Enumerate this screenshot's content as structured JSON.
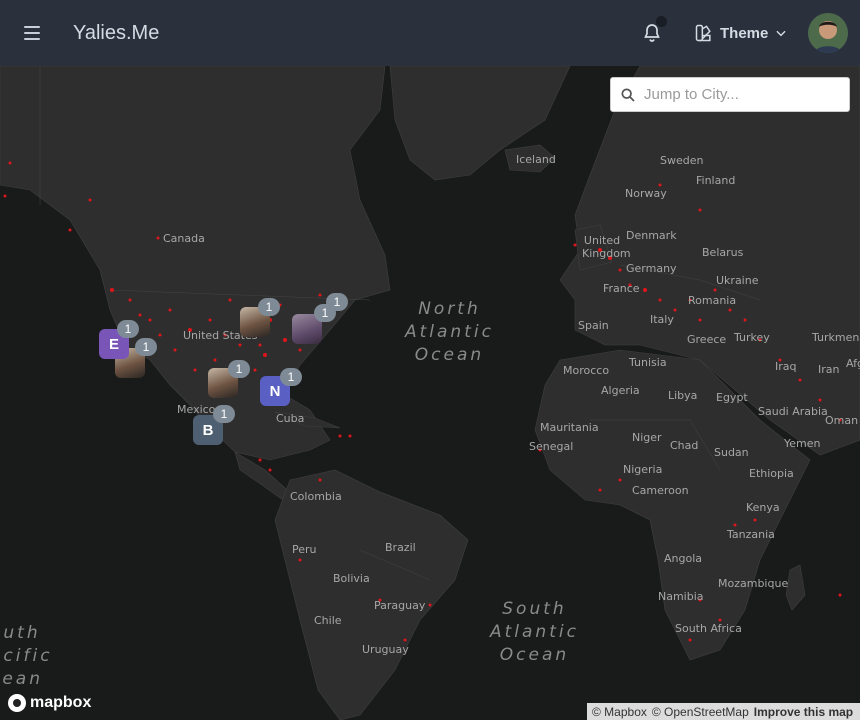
{
  "header": {
    "brand": "Yalies.Me",
    "theme_label": "Theme"
  },
  "search": {
    "placeholder": "Jump to City..."
  },
  "map": {
    "ocean_labels": {
      "north_atlantic": "North\nAtlantic\nOcean",
      "south_atlantic": "South\nAtlantic\nOcean",
      "south_pacific": "outh\nacific\ncean"
    },
    "place_labels": [
      "Iceland",
      "Sweden",
      "Finland",
      "Norway",
      "United Kingdom",
      "Denmark",
      "Belarus",
      "Germany",
      "Ukraine",
      "France",
      "Romania",
      "Spain",
      "Italy",
      "Turkey",
      "Greece",
      "Turkmen",
      "Tunisia",
      "Iraq",
      "Iran",
      "Afg",
      "Morocco",
      "Algeria",
      "Libya",
      "Egypt",
      "Saudi Arabia",
      "Oman",
      "Mauritania",
      "Niger",
      "Chad",
      "Sudan",
      "Yemen",
      "Senegal",
      "Nigeria",
      "Ethiopia",
      "Cameroon",
      "Kenya",
      "Tanzania",
      "Angola",
      "Mozambique",
      "Namibia",
      "South Africa",
      "Canada",
      "United States",
      "Mexico",
      "Cuba",
      "Colombia",
      "Peru",
      "Brazil",
      "Bolivia",
      "Paraguay",
      "Chile",
      "Uruguay"
    ],
    "markers": [
      {
        "type": "letter",
        "text": "E",
        "color": "#7a55b8",
        "count": "1"
      },
      {
        "type": "letter",
        "text": "N",
        "color": "#5a5fc4",
        "count": "1"
      },
      {
        "type": "letter",
        "text": "B",
        "color": "#4e5f72",
        "count": "1"
      },
      {
        "type": "photo",
        "count": "1"
      },
      {
        "type": "photo",
        "count": "1"
      },
      {
        "type": "photo",
        "count": "1"
      },
      {
        "type": "photo",
        "count": "1"
      },
      {
        "type": "photo",
        "count": "1"
      }
    ]
  },
  "footer": {
    "logo_text": "mapbox",
    "attribution_mapbox": "© Mapbox",
    "attribution_osm": "© OpenStreetMap",
    "improve": "Improve this map"
  }
}
